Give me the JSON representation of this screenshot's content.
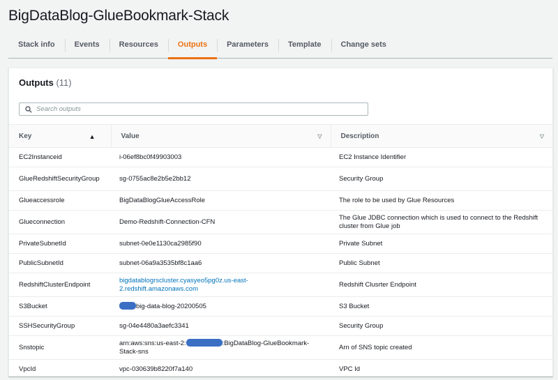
{
  "page_title": "BigDataBlog-GlueBookmark-Stack",
  "tabs": [
    {
      "label": "Stack info",
      "active": false
    },
    {
      "label": "Events",
      "active": false
    },
    {
      "label": "Resources",
      "active": false
    },
    {
      "label": "Outputs",
      "active": true
    },
    {
      "label": "Parameters",
      "active": false
    },
    {
      "label": "Template",
      "active": false
    },
    {
      "label": "Change sets",
      "active": false
    }
  ],
  "outputs": {
    "title": "Outputs",
    "count": "(11)",
    "search_placeholder": "Search outputs",
    "columns": {
      "key": "Key",
      "value": "Value",
      "description": "Description"
    },
    "rows": [
      {
        "key": "EC2Instanceid",
        "value": "i-06ef8bc0f49903003",
        "description": "EC2 Instance Identifier"
      },
      {
        "key": "GlueRedshiftSecurityGroup",
        "value": "sg-0755ac8e2b5e2bb12",
        "description": "Security Group"
      },
      {
        "key": "Glueaccessrole",
        "value": "BigDataBlogGlueAccessRole",
        "description": "The role to be used by Glue Resources"
      },
      {
        "key": "Glueconnection",
        "value": "Demo-Redshift-Connection-CFN",
        "description": "The Glue JDBC connection which is used to connect to the Redshift cluster from Glue job"
      },
      {
        "key": "PrivateSubnetId",
        "value": "subnet-0e0e1130ca2985f90",
        "description": "Private Subnet"
      },
      {
        "key": "PublicSubnetId",
        "value": "subnet-06a9a3535bf8c1aa6",
        "description": "Public Subnet"
      },
      {
        "key": "RedshiftClusterEndpoint",
        "value": "bigdatablogrscluster.cyasyeo5pg0z.us-east-2.redshift.amazonaws.com",
        "description": "Redshift Clusrter Endpoint",
        "is_link": true
      },
      {
        "key": "S3Bucket",
        "value_suffix": "big-data-blog-20200505",
        "description": "S3 Bucket"
      },
      {
        "key": "SSHSecurityGroup",
        "value": "sg-04e4480a3aefc3341",
        "description": "Security Group"
      },
      {
        "key": "Snstopic",
        "value_prefix": "arn:aws:sns:us-east-2:",
        "value_suffix": ":BigDataBlog-GlueBookmark-Stack-sns",
        "description": "Arn of SNS topic created"
      },
      {
        "key": "VpcId",
        "value": "vpc-030639b8220f7a140",
        "description": "VPC Id"
      }
    ]
  },
  "colors": {
    "accent": "#ec7211",
    "link": "#0073bb",
    "redaction": "#3a6fc4"
  }
}
